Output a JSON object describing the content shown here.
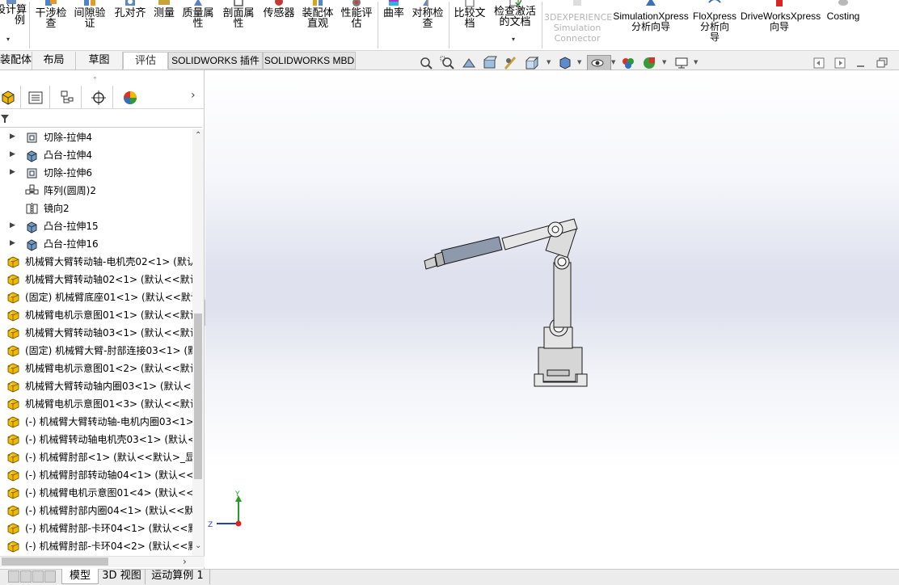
{
  "ribbon": {
    "design_study": "设计算\n例",
    "interference": "干涉检\n查",
    "clearance": "间隙验\n证",
    "hole_align": "孔对齐",
    "measure": "测量",
    "mass_props": "质量属\n性",
    "section_props": "剖面属\n性",
    "sensor": "传感器",
    "assembly_visual": "装配体\n直观",
    "performance": "性能评\n估",
    "curvature": "曲率",
    "symmetry": "对称检\n查",
    "compare": "比较文\n档",
    "check_active": "检查激活\n的文档",
    "experience": "3DEXPERIENCE\nSimulation\nConnector",
    "simxpress": "SimulationXpress\n分析向导",
    "floxpress": "FloXpress\n分析向\n导",
    "driveworks": "DriveWorksXpress\n向导",
    "costing": "Costing"
  },
  "tabs": [
    {
      "label": "装配体"
    },
    {
      "label": "布局"
    },
    {
      "label": "草图"
    },
    {
      "label": "评估"
    },
    {
      "label": "SOLIDWORKS 插件"
    },
    {
      "label": "SOLIDWORKS MBD"
    }
  ],
  "tree": [
    {
      "label": "切除-拉伸4",
      "icon": "extrude-cut-icon"
    },
    {
      "label": "凸台-拉伸4",
      "icon": "boss-extrude-icon"
    },
    {
      "label": "切除-拉伸6",
      "icon": "extrude-cut-icon"
    },
    {
      "label": "阵列(圆周)2",
      "icon": "circular-pattern-icon"
    },
    {
      "label": "镜向2",
      "icon": "mirror-icon"
    },
    {
      "label": "凸台-拉伸15",
      "icon": "boss-extrude-icon"
    },
    {
      "label": "凸台-拉伸16",
      "icon": "boss-extrude-icon"
    },
    {
      "label": "机械臂大臂转动轴-电机壳02<1> (默认"
    },
    {
      "label": "机械臂大臂转动轴02<1> (默认<<默认"
    },
    {
      "label": "(固定) 机械臂底座01<1> (默认<<默认"
    },
    {
      "label": "机械臂电机示意图01<1> (默认<<默认"
    },
    {
      "label": "机械臂大臂转动轴03<1> (默认<<默认"
    },
    {
      "label": "(固定) 机械臂大臂-肘部连接03<1> (默"
    },
    {
      "label": "机械臂电机示意图01<2> (默认<<默认"
    },
    {
      "label": "机械臂大臂转动轴内圈03<1> (默认<<"
    },
    {
      "label": "机械臂电机示意图01<3> (默认<<默认"
    },
    {
      "label": "(-) 机械臂大臂转动轴-电机内圈03<1>"
    },
    {
      "label": "(-) 机械臂转动轴电机壳03<1> (默认<"
    },
    {
      "label": "(-) 机械臂肘部<1> (默认<<默认>_显示"
    },
    {
      "label": "(-) 机械臂肘部转动轴04<1> (默认<<默"
    },
    {
      "label": "(-) 机械臂电机示意图01<4> (默认<<默"
    },
    {
      "label": "(-) 机械臂肘部内圈04<1> (默认<<默认"
    },
    {
      "label": "(-) 机械臂肘部-卡环04<1> (默认<<默认"
    },
    {
      "label": "(-) 机械臂肘部-卡环04<2> (默认<<默认"
    }
  ],
  "triad": {
    "y": "Y",
    "z": "Z"
  },
  "bottom_tabs": [
    {
      "label": "模型"
    },
    {
      "label": "3D 视图"
    },
    {
      "label": "运动算例 1"
    }
  ],
  "colors": {
    "part_yellow": "#f1b800",
    "arm_grey": "#d6d6d6",
    "accent": "#1a6fc7"
  }
}
